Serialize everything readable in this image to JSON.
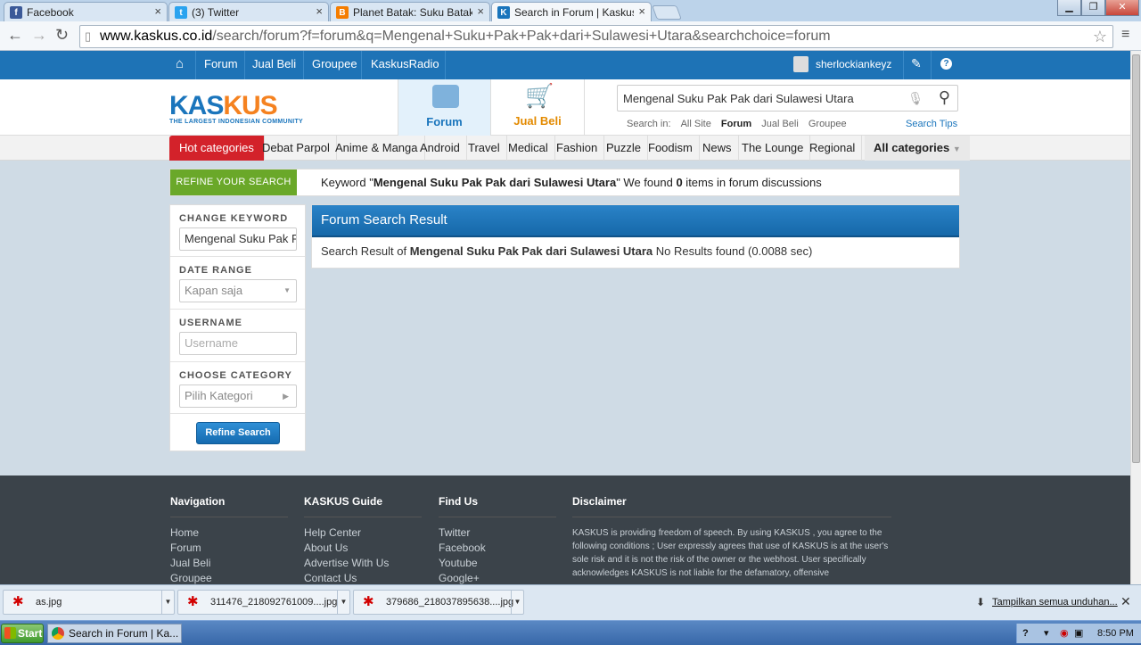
{
  "browser": {
    "tabs": [
      {
        "title": "Facebook",
        "icon": "facebook-icon",
        "color": "#3b5998"
      },
      {
        "title": "(3) Twitter",
        "icon": "twitter-icon",
        "color": "#2aa3ef"
      },
      {
        "title": "Planet Batak: Suku Batak P",
        "icon": "blogger-icon",
        "color": "#f57d00"
      },
      {
        "title": "Search in Forum | Kaskus - T",
        "icon": "kaskus-icon",
        "color": "#1a75bc"
      }
    ],
    "url_domain": "www.kaskus.co.id",
    "url_path": "/search/forum?f=forum&q=Mengenal+Suku+Pak+Pak+dari+Sulawesi+Utara&searchchoice=forum"
  },
  "site": {
    "topnav": {
      "items": [
        "Forum",
        "Jual Beli",
        "Groupee",
        "KaskusRadio"
      ],
      "username": "sherlockiankeyz"
    },
    "logo": {
      "text_a": "KAS",
      "text_b": "KUS",
      "tagline": "THE LARGEST INDONESIAN COMMUNITY"
    },
    "header_tabs": {
      "forum": "Forum",
      "jualbeli": "Jual Beli"
    },
    "search": {
      "value": "Mengenal Suku Pak Pak dari Sulawesi Utara",
      "in_label": "Search in:",
      "options": [
        "All Site",
        "Forum",
        "Jual Beli",
        "Groupee"
      ],
      "tips": "Search Tips"
    },
    "categories": {
      "hot": "Hot categories",
      "items": [
        "Debat Parpol",
        "Anime & Manga",
        "Android",
        "Travel",
        "Medical",
        "Fashion",
        "Puzzle",
        "Foodism",
        "News",
        "The Lounge",
        "Regional"
      ],
      "all": "All categories"
    }
  },
  "refine": {
    "label": "REFINE YOUR SEARCH",
    "summary_a": "Keyword \"",
    "summary_kw": "Mengenal Suku Pak Pak dari Sulawesi Utara",
    "summary_b": "\" We found ",
    "summary_count": "0",
    "summary_c": " items in forum discussions"
  },
  "sidebar": {
    "change_keyword_label": "CHANGE KEYWORD",
    "keyword_value": "Mengenal Suku Pak Pak dari Sulawesi Utara",
    "date_range_label": "DATE RANGE",
    "date_range_value": "Kapan saja",
    "username_label": "USERNAME",
    "username_placeholder": "Username",
    "category_label": "CHOOSE CATEGORY",
    "category_value": "Pilih Kategori",
    "refine_button": "Refine Search"
  },
  "result": {
    "title": "Forum Search Result",
    "prefix": "Search Result of ",
    "keyword": "Mengenal Suku Pak Pak dari Sulawesi Utara",
    "suffix": " No Results found (0.0088 sec)"
  },
  "footer": {
    "navigation": {
      "title": "Navigation",
      "links": [
        "Home",
        "Forum",
        "Jual Beli",
        "Groupee"
      ]
    },
    "guide": {
      "title": "KASKUS Guide",
      "links": [
        "Help Center",
        "About Us",
        "Advertise With Us",
        "Contact Us"
      ]
    },
    "findus": {
      "title": "Find Us",
      "links": [
        "Twitter",
        "Facebook",
        "Youtube",
        "Google+"
      ]
    },
    "disclaimer": {
      "title": "Disclaimer",
      "text": "KASKUS is providing freedom of speech. By using KASKUS , you agree to the following conditions ; User expressly agrees that use of KASKUS is at the user's sole risk and it is not the risk of the owner or the webhost. User specifically acknowledges KASKUS is not liable for the defamatory, offensive"
    }
  },
  "downloads": {
    "items": [
      "as.jpg",
      "311476_218092761009....jpg",
      "379686_218037895638....jpg"
    ],
    "show_all": "Tampilkan semua unduhan..."
  },
  "taskbar": {
    "start": "Start",
    "task": "Search in Forum | Ka...",
    "time": "8:50 PM"
  }
}
